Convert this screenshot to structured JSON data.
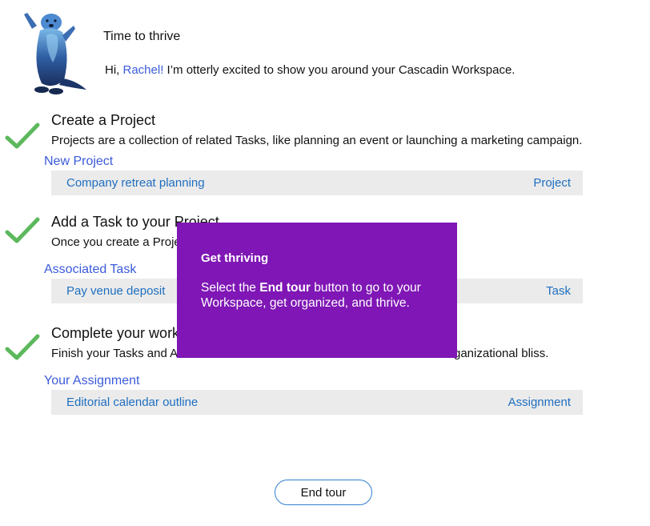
{
  "hero": {
    "title": "Time to thrive",
    "greeting_prefix": "Hi, ",
    "user_name": "Rachel!",
    "greeting_suffix": " I’m otterly excited to show you around your Cascadin Workspace."
  },
  "steps": [
    {
      "title": "Create a Project",
      "description": "Projects are a collection of related Tasks, like planning an event or launching a marketing campaign.",
      "item_label": "New Project",
      "item_name": "Company retreat planning",
      "item_type": "Project",
      "completed": true
    },
    {
      "title": "Add a Task to your Project",
      "description": "Once you create a Project",
      "item_label": "Associated Task",
      "item_name": "Pay venue deposit",
      "item_type": "Task",
      "completed": true
    },
    {
      "title": "Complete your work",
      "description": "Finish your Tasks and A",
      "description_end": "ganizational bliss.",
      "item_label": "Your Assignment",
      "item_name": "Editorial calendar outline",
      "item_type": "Assignment",
      "completed": true
    }
  ],
  "tooltip": {
    "title": "Get thriving",
    "body_prefix": "Select the ",
    "body_bold": "End tour",
    "body_suffix": " button to go to your Workspace, get organized, and thrive."
  },
  "end_tour_label": "End tour",
  "colors": {
    "accent_link": "#3b5bdb",
    "row_text": "#1f6fc0",
    "check_green": "#5cb85c",
    "tooltip_bg": "#7f16b5",
    "row_bg": "#ebebeb"
  }
}
